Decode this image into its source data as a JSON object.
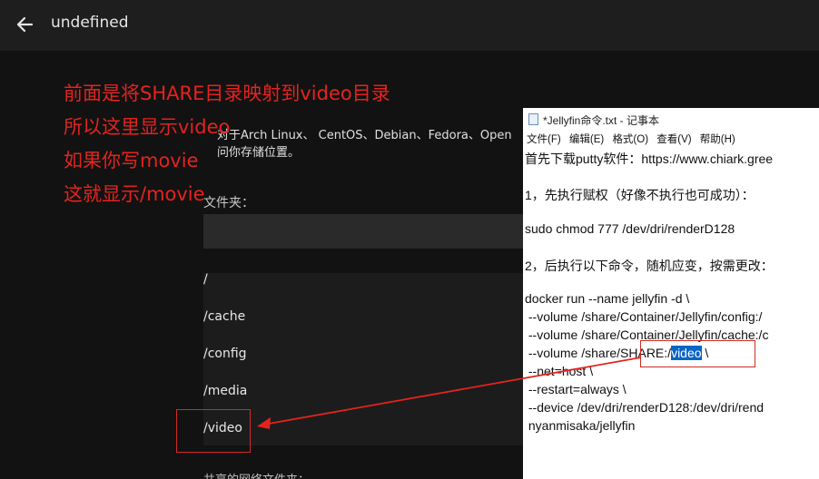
{
  "header": {
    "title": "undefined"
  },
  "annotation": {
    "lines": [
      "前面是将SHARE目录映射到video目录",
      "所以这里显示video",
      "如果你写movie",
      "这就显示/movie"
    ]
  },
  "dialog": {
    "description_line1": "对于Arch Linux、 CentOS、Debian、Fedora、Open",
    "description_line2": "问你存储位置。",
    "folder_label": "文件夹：",
    "folder_value": "",
    "folders": [
      "/",
      "/cache",
      "/config",
      "/media",
      "/video"
    ],
    "more_label": "共享的网络文件夹："
  },
  "notepad": {
    "title": "*Jellyfin命令.txt - 记事本",
    "menu": [
      "文件(F)",
      "编辑(E)",
      "格式(O)",
      "查看(V)",
      "帮助(H)"
    ],
    "lines": {
      "l1": "首先下载putty软件：https://www.chiark.gree",
      "l2": "1，先执行赋权（好像不执行也可成功）：",
      "l3": "sudo chmod 777 /dev/dri/renderD128",
      "l4": "2，后执行以下命令，随机应变，按需更改：",
      "l5": "docker run --name jellyfin -d \\",
      "l6": " --volume /share/Container/Jellyfin/config:/",
      "l7": " --volume /share/Container/Jellyfin/cache:/c",
      "l8a": " --volume /share/SHARE:/",
      "l8b": "video",
      "l8c": " \\",
      "l9": " --net=host \\",
      "l10": " --restart=always \\",
      "l11": " --device /dev/dri/renderD128:/dev/dri/rend",
      "l12": " nyanmisaka/jellyfin"
    }
  },
  "colors": {
    "annotation_red": "#e3231f",
    "selection_blue": "#0a64c8"
  },
  "icons": {
    "back": "arrow-left-icon",
    "notepad": "notepad-icon"
  }
}
